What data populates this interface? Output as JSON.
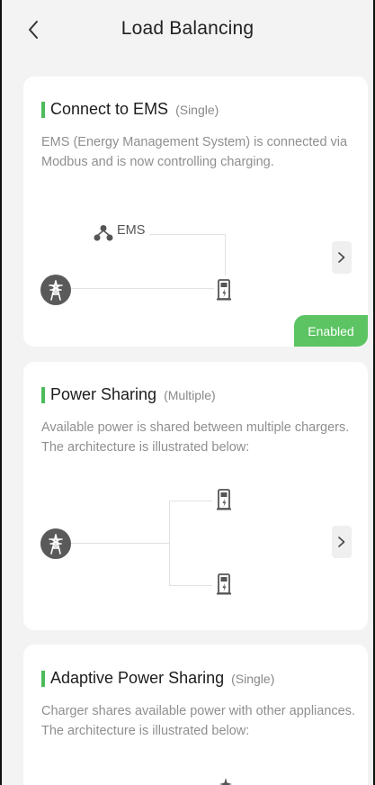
{
  "header": {
    "title": "Load Balancing",
    "back_icon": "chevron-left-icon"
  },
  "cards": [
    {
      "title": "Connect to EMS",
      "mode": "(Single)",
      "description": "EMS (Energy Management System) is connected via Modbus and is now controlling charging.",
      "diagram_label": "EMS",
      "status": "Enabled"
    },
    {
      "title": "Power Sharing",
      "mode": "(Multiple)",
      "description": "Available power is shared between multiple chargers. The architecture is illustrated below:"
    },
    {
      "title": "Adaptive Power Sharing",
      "mode": "(Single)",
      "description": "Charger shares available power with other appliances. The architecture is illustrated below:"
    }
  ],
  "colors": {
    "accent": "#4cbb5a",
    "enabled_badge": "#5cc463",
    "page_bg": "#f3f3f3",
    "card_bg": "#ffffff"
  },
  "icons": [
    "chevron-left-icon",
    "chevron-right-icon",
    "grid-tower-icon",
    "charger-icon",
    "ems-network-icon",
    "adaptive-power-icon"
  ]
}
